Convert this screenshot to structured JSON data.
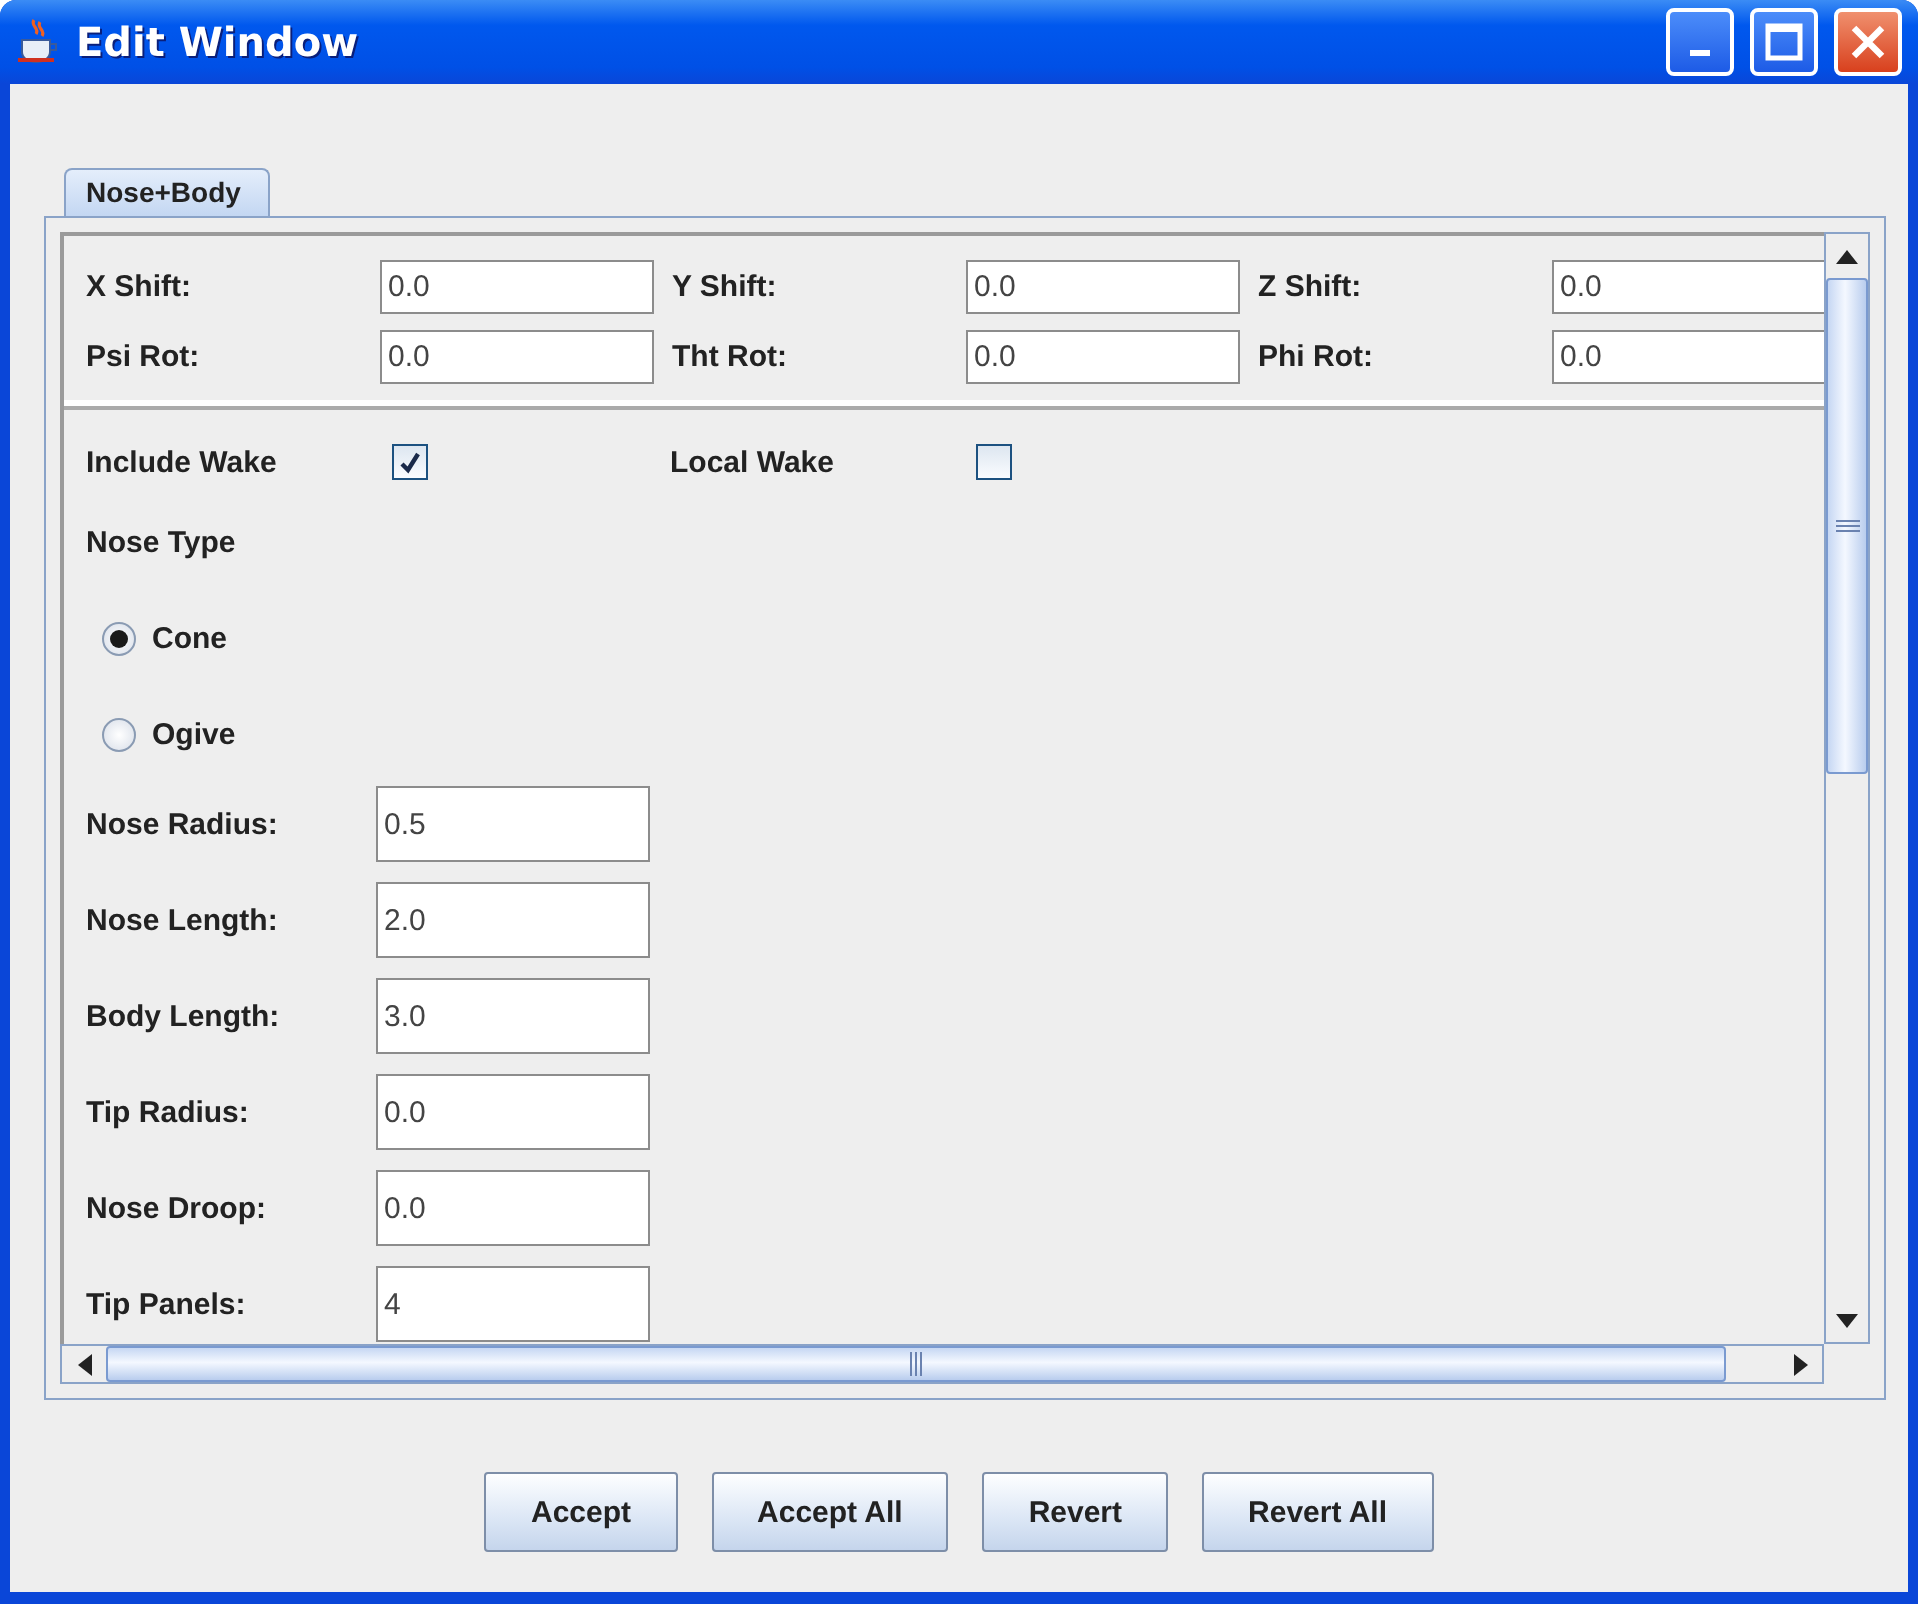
{
  "window": {
    "title": "Edit Window"
  },
  "tabs": [
    {
      "label": "Nose+Body",
      "selected": true
    }
  ],
  "transform_fields": [
    {
      "label": "X Shift:",
      "value": "0.0"
    },
    {
      "label": "Y Shift:",
      "value": "0.0"
    },
    {
      "label": "Z Shift:",
      "value": "0.0"
    },
    {
      "label": "Psi Rot:",
      "value": "0.0"
    },
    {
      "label": "Tht Rot:",
      "value": "0.0"
    },
    {
      "label": "Phi Rot:",
      "value": "0.0"
    }
  ],
  "options": [
    {
      "label": "Include Wake",
      "checked": true
    },
    {
      "label": "Local Wake",
      "checked": false
    }
  ],
  "nose_type": {
    "label": "Nose Type",
    "choices": [
      {
        "label": "Cone",
        "selected": true
      },
      {
        "label": "Ogive",
        "selected": false
      }
    ]
  },
  "parameters": [
    {
      "label": "Nose Radius:",
      "value": "0.5"
    },
    {
      "label": "Nose Length:",
      "value": "2.0"
    },
    {
      "label": "Body Length:",
      "value": "3.0"
    },
    {
      "label": "Tip Radius:",
      "value": "0.0"
    },
    {
      "label": "Nose Droop:",
      "value": "0.0"
    },
    {
      "label": "Tip Panels:",
      "value": "4"
    }
  ],
  "buttons": [
    "Accept",
    "Accept All",
    "Revert",
    "Revert All"
  ]
}
